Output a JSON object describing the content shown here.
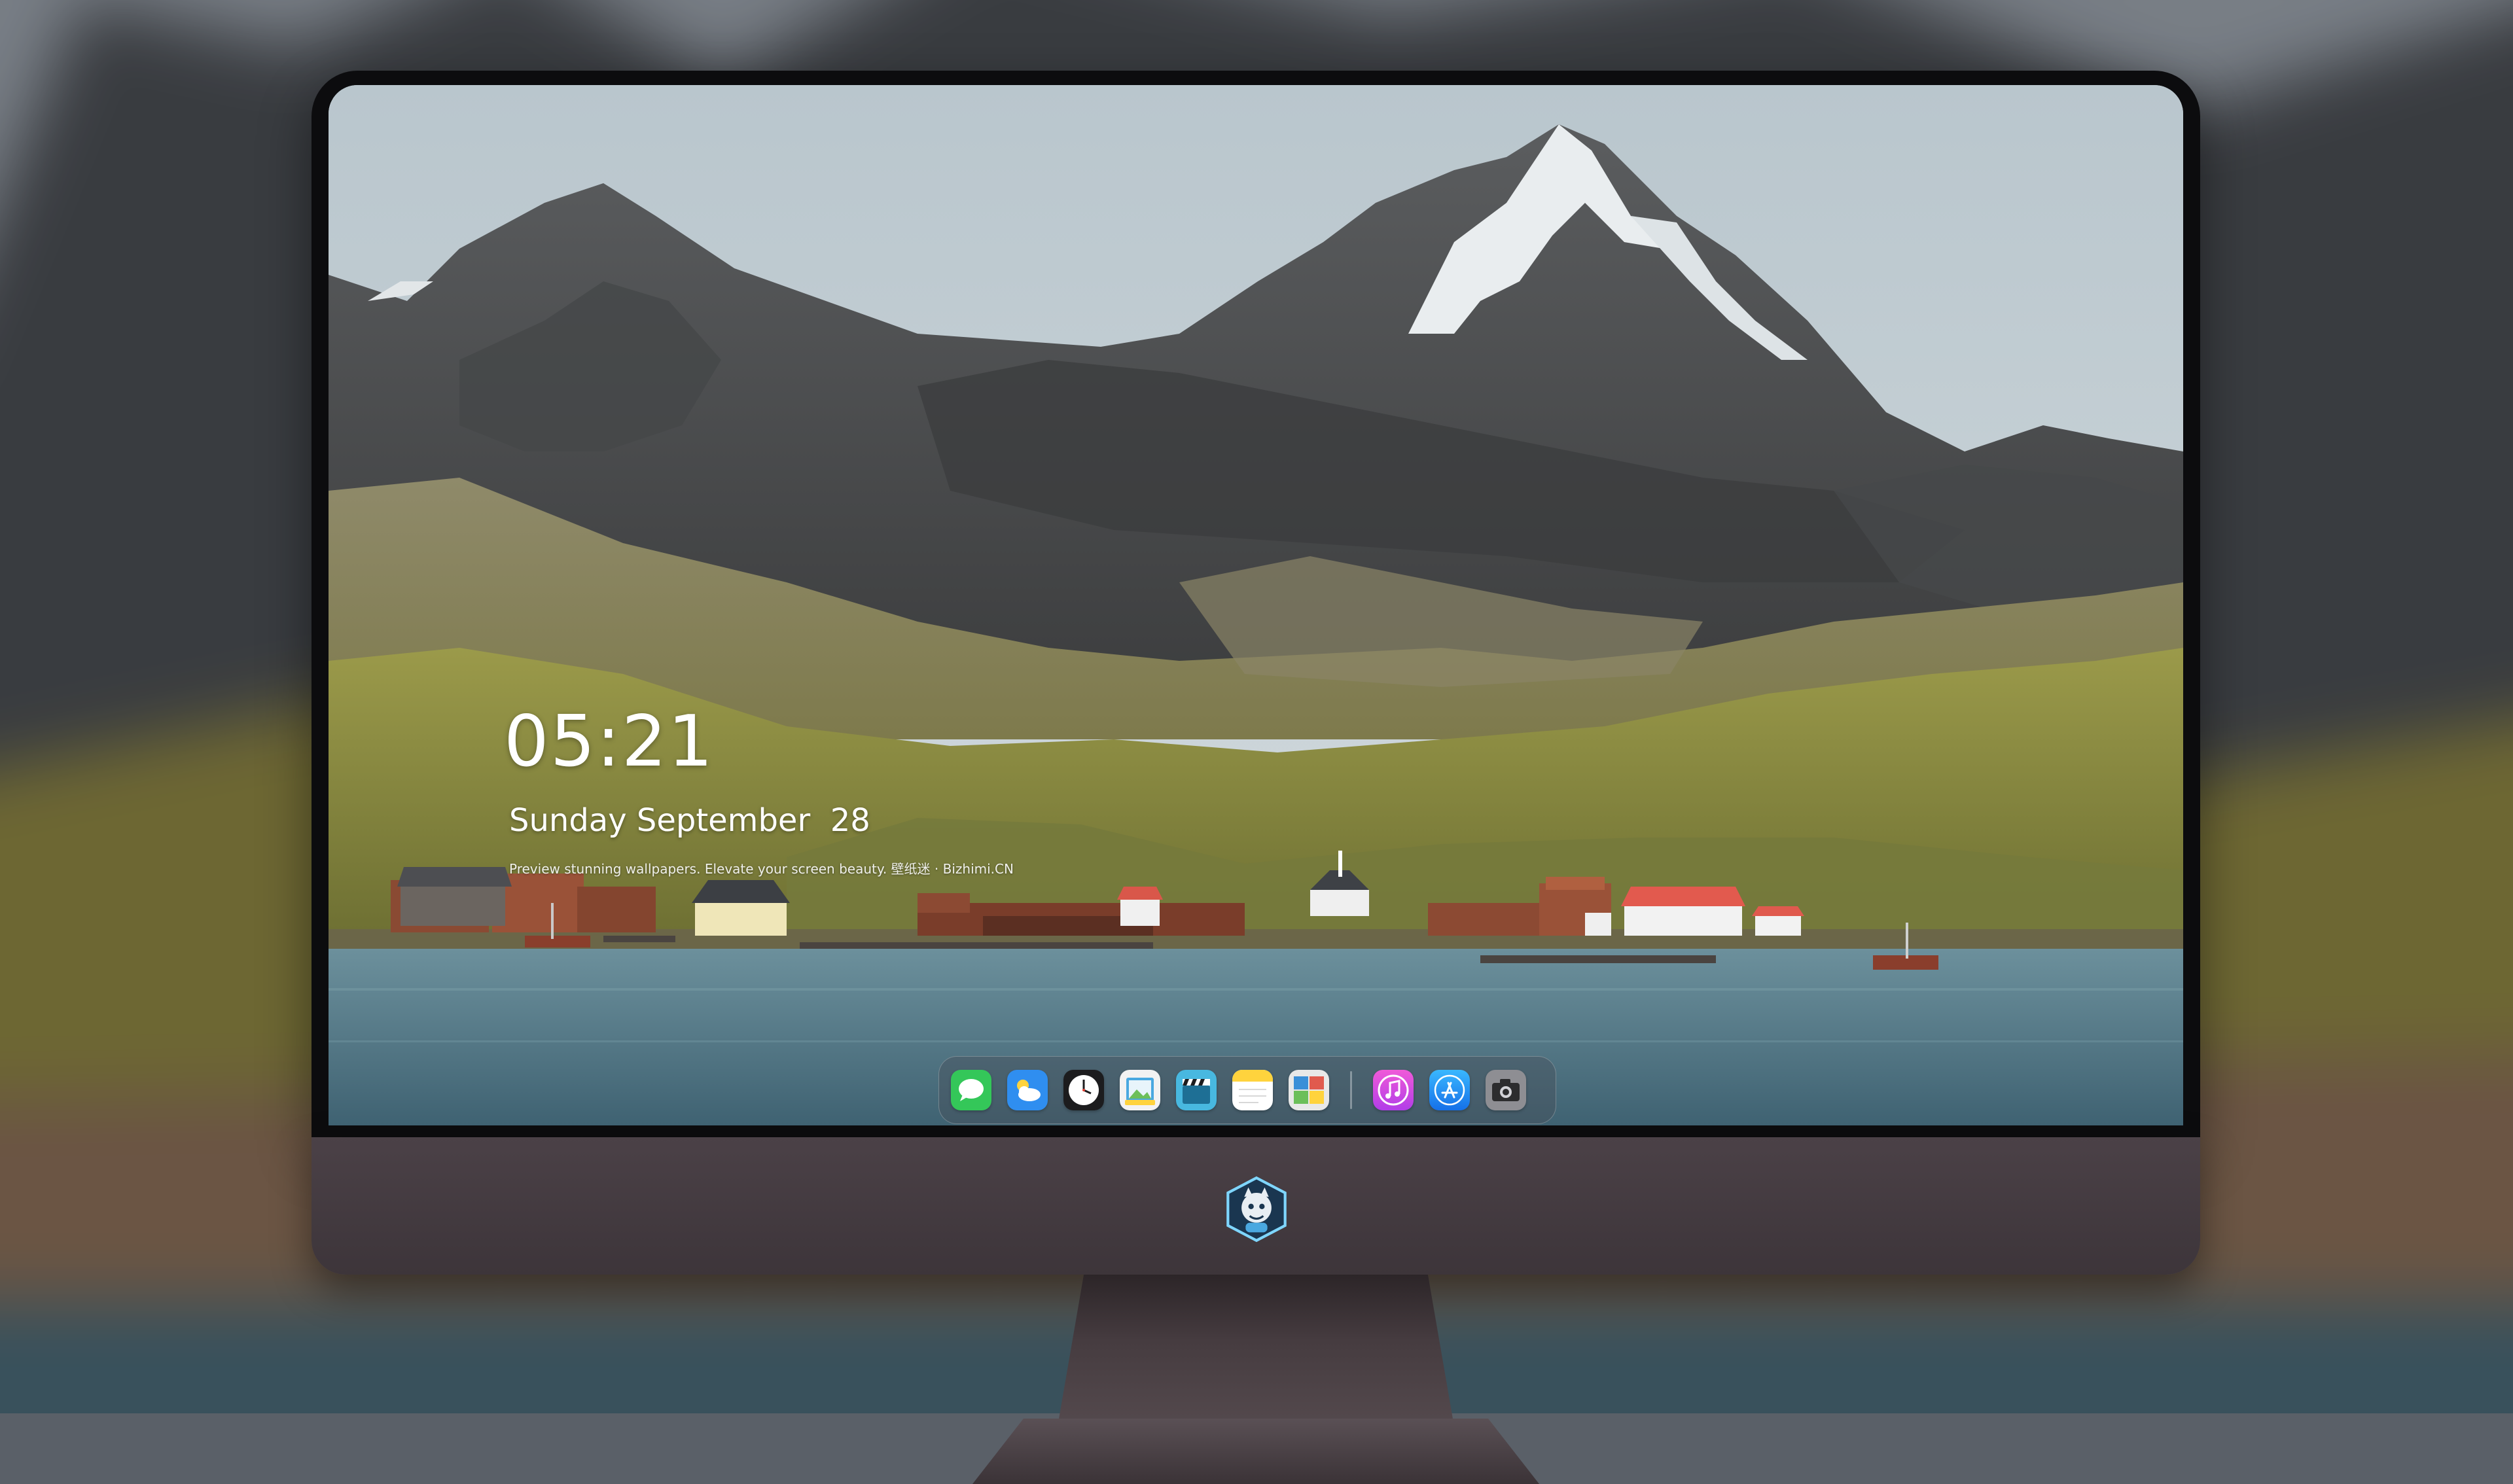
{
  "lock_screen": {
    "time": "05:21",
    "date": "Sunday September  28",
    "tagline": "Preview stunning wallpapers. Elevate your screen beauty. 壁纸迷 · Bizhimi.CN"
  },
  "dock": {
    "apps": [
      {
        "name": "Messages",
        "icon": "message-bubble-icon",
        "color": "#34c759"
      },
      {
        "name": "Weather",
        "icon": "weather-cloud-icon",
        "color": "#2f8ef0"
      },
      {
        "name": "Clock",
        "icon": "clock-icon",
        "color": "#1c1c1e"
      },
      {
        "name": "Preview",
        "icon": "preview-icon",
        "color": "#f2f2f2"
      },
      {
        "name": "Clips",
        "icon": "clapperboard-icon",
        "color": "#48b8e0"
      },
      {
        "name": "Notes",
        "icon": "notes-icon",
        "color": "#ffd33d"
      },
      {
        "name": "Photo Booth",
        "icon": "photo-booth-icon",
        "color": "#3a8fd8"
      },
      {
        "name": "iTunes",
        "icon": "music-note-icon",
        "color": "#e04ff0"
      },
      {
        "name": "App Store",
        "icon": "app-store-icon",
        "color": "#1a8cf0"
      },
      {
        "name": "Camera",
        "icon": "camera-icon",
        "color": "#6e6e73"
      }
    ]
  },
  "colors": {
    "sky": "#c8d3d9",
    "water": "#4f7584",
    "bezel": "#0c0c0e",
    "chin": "#433a3f"
  }
}
